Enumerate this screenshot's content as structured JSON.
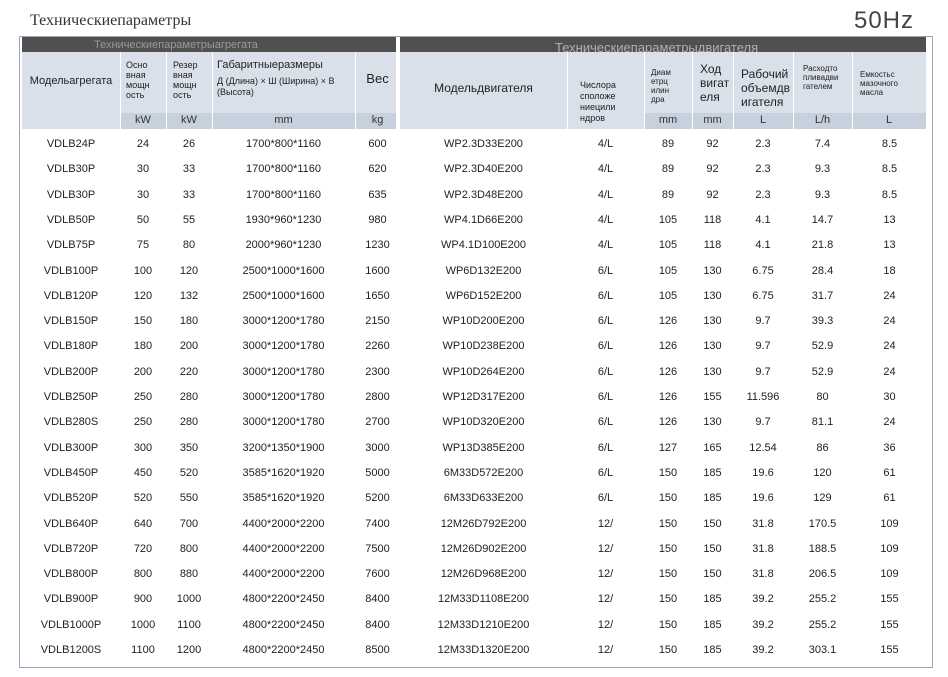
{
  "title": "Техническиепараметры",
  "frequency": "50Hz",
  "section_left": "Техническиепараметрыагрегата",
  "section_right": "Техническиепараметрыдвигателя",
  "headers": {
    "model": "Модельагрегата",
    "main_power": "Осно вная мощн ость",
    "reserve_power": "Резер вная мощн ость",
    "dimensions": "Габаритныеразмеры",
    "dimensions_sub": "Д (Длина) × Ш (Ширина) × В (Высота)",
    "weight": "Вес",
    "engine_model": "Модельдвигателя",
    "cylinders": "Числоpa сположе ниецили ндров",
    "bore": "Диам етрц илин дра",
    "stroke": "Ход вигат еля",
    "displacement": "Рабочий объемдв игателя",
    "fuel_consumption": "Расходто пливадви гателем",
    "oil_capacity": "Емкостьс мазочного масла"
  },
  "units": {
    "main_power": "kW",
    "reserve_power": "kW",
    "dimensions": "mm",
    "weight": "kg",
    "bore": "mm",
    "stroke": "mm",
    "displacement": "L",
    "fuel_consumption": "L/h",
    "oil_capacity": "L"
  },
  "rows": [
    {
      "model": "VDLB24P",
      "main": "24",
      "reserve": "26",
      "dims": "1700*800*1160",
      "weight": "600",
      "engine": "WP2.3D33E200",
      "cyl": "4/L",
      "bore": "89",
      "stroke": "92",
      "disp": "2.3",
      "fuel": "7.4",
      "oil": "8.5"
    },
    {
      "model": "VDLB30P",
      "main": "30",
      "reserve": "33",
      "dims": "1700*800*1160",
      "weight": "620",
      "engine": "WP2.3D40E200",
      "cyl": "4/L",
      "bore": "89",
      "stroke": "92",
      "disp": "2.3",
      "fuel": "9.3",
      "oil": "8.5"
    },
    {
      "model": "VDLB30P",
      "main": "30",
      "reserve": "33",
      "dims": "1700*800*1160",
      "weight": "635",
      "engine": "WP2.3D48E200",
      "cyl": "4/L",
      "bore": "89",
      "stroke": "92",
      "disp": "2.3",
      "fuel": "9.3",
      "oil": "8.5"
    },
    {
      "model": "VDLB50P",
      "main": "50",
      "reserve": "55",
      "dims": "1930*960*1230",
      "weight": "980",
      "engine": "WP4.1D66E200",
      "cyl": "4/L",
      "bore": "105",
      "stroke": "118",
      "disp": "4.1",
      "fuel": "14.7",
      "oil": "13"
    },
    {
      "model": "VDLB75P",
      "main": "75",
      "reserve": "80",
      "dims": "2000*960*1230",
      "weight": "1230",
      "engine": "WP4.1D100E200",
      "cyl": "4/L",
      "bore": "105",
      "stroke": "118",
      "disp": "4.1",
      "fuel": "21.8",
      "oil": "13"
    },
    {
      "model": "VDLB100P",
      "main": "100",
      "reserve": "120",
      "dims": "2500*1000*1600",
      "weight": "1600",
      "engine": "WP6D132E200",
      "cyl": "6/L",
      "bore": "105",
      "stroke": "130",
      "disp": "6.75",
      "fuel": "28.4",
      "oil": "18"
    },
    {
      "model": "VDLB120P",
      "main": "120",
      "reserve": "132",
      "dims": "2500*1000*1600",
      "weight": "1650",
      "engine": "WP6D152E200",
      "cyl": "6/L",
      "bore": "105",
      "stroke": "130",
      "disp": "6.75",
      "fuel": "31.7",
      "oil": "24"
    },
    {
      "model": "VDLB150P",
      "main": "150",
      "reserve": "180",
      "dims": "3000*1200*1780",
      "weight": "2150",
      "engine": "WP10D200E200",
      "cyl": "6/L",
      "bore": "126",
      "stroke": "130",
      "disp": "9.7",
      "fuel": "39.3",
      "oil": "24"
    },
    {
      "model": "VDLB180P",
      "main": "180",
      "reserve": "200",
      "dims": "3000*1200*1780",
      "weight": "2260",
      "engine": "WP10D238E200",
      "cyl": "6/L",
      "bore": "126",
      "stroke": "130",
      "disp": "9.7",
      "fuel": "52.9",
      "oil": "24"
    },
    {
      "model": "VDLB200P",
      "main": "200",
      "reserve": "220",
      "dims": "3000*1200*1780",
      "weight": "2300",
      "engine": "WP10D264E200",
      "cyl": "6/L",
      "bore": "126",
      "stroke": "130",
      "disp": "9.7",
      "fuel": "52.9",
      "oil": "24"
    },
    {
      "model": "VDLB250P",
      "main": "250",
      "reserve": "280",
      "dims": "3000*1200*1780",
      "weight": "2800",
      "engine": "WP12D317E200",
      "cyl": "6/L",
      "bore": "126",
      "stroke": "155",
      "disp": "11.596",
      "fuel": "80",
      "oil": "30"
    },
    {
      "model": "VDLB280S",
      "main": "250",
      "reserve": "280",
      "dims": "3000*1200*1780",
      "weight": "2700",
      "engine": "WP10D320E200",
      "cyl": "6/L",
      "bore": "126",
      "stroke": "130",
      "disp": "9.7",
      "fuel": "81.1",
      "oil": "24"
    },
    {
      "model": "VDLB300P",
      "main": "300",
      "reserve": "350",
      "dims": "3200*1350*1900",
      "weight": "3000",
      "engine": "WP13D385E200",
      "cyl": "6/L",
      "bore": "127",
      "stroke": "165",
      "disp": "12.54",
      "fuel": "86",
      "oil": "36"
    },
    {
      "model": "VDLB450P",
      "main": "450",
      "reserve": "520",
      "dims": "3585*1620*1920",
      "weight": "5000",
      "engine": "6M33D572E200",
      "cyl": "6/L",
      "bore": "150",
      "stroke": "185",
      "disp": "19.6",
      "fuel": "120",
      "oil": "61"
    },
    {
      "model": "VDLB520P",
      "main": "520",
      "reserve": "550",
      "dims": "3585*1620*1920",
      "weight": "5200",
      "engine": "6M33D633E200",
      "cyl": "6/L",
      "bore": "150",
      "stroke": "185",
      "disp": "19.6",
      "fuel": "129",
      "oil": "61"
    },
    {
      "model": "VDLB640P",
      "main": "640",
      "reserve": "700",
      "dims": "4400*2000*2200",
      "weight": "7400",
      "engine": "12M26D792E200",
      "cyl": "12/",
      "bore": "150",
      "stroke": "150",
      "disp": "31.8",
      "fuel": "170.5",
      "oil": "109"
    },
    {
      "model": "VDLB720P",
      "main": "720",
      "reserve": "800",
      "dims": "4400*2000*2200",
      "weight": "7500",
      "engine": "12M26D902E200",
      "cyl": "12/",
      "bore": "150",
      "stroke": "150",
      "disp": "31.8",
      "fuel": "188.5",
      "oil": "109"
    },
    {
      "model": "VDLB800P",
      "main": "800",
      "reserve": "880",
      "dims": "4400*2000*2200",
      "weight": "7600",
      "engine": "12M26D968E200",
      "cyl": "12/",
      "bore": "150",
      "stroke": "150",
      "disp": "31.8",
      "fuel": "206.5",
      "oil": "109"
    },
    {
      "model": "VDLB900P",
      "main": "900",
      "reserve": "1000",
      "dims": "4800*2200*2450",
      "weight": "8400",
      "engine": "12M33D1108E200",
      "cyl": "12/",
      "bore": "150",
      "stroke": "185",
      "disp": "39.2",
      "fuel": "255.2",
      "oil": "155"
    },
    {
      "model": "VDLB1000P",
      "main": "1000",
      "reserve": "1100",
      "dims": "4800*2200*2450",
      "weight": "8400",
      "engine": "12M33D1210E200",
      "cyl": "12/",
      "bore": "150",
      "stroke": "185",
      "disp": "39.2",
      "fuel": "255.2",
      "oil": "155"
    },
    {
      "model": "VDLB1200S",
      "main": "1100",
      "reserve": "1200",
      "dims": "4800*2200*2450",
      "weight": "8500",
      "engine": "12M33D1320E200",
      "cyl": "12/",
      "bore": "150",
      "stroke": "185",
      "disp": "39.2",
      "fuel": "303.1",
      "oil": "155"
    }
  ]
}
